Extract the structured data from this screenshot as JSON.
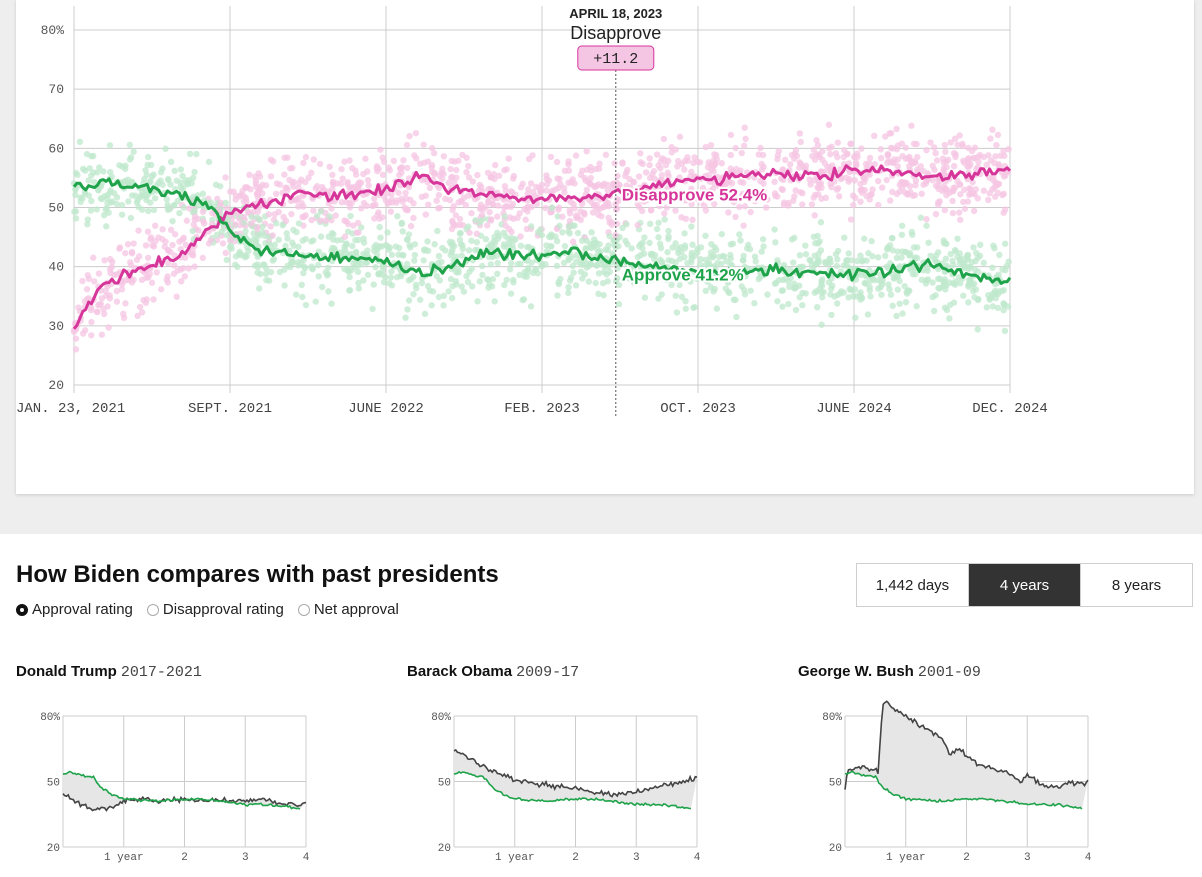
{
  "colors": {
    "approve": "#1ea34a",
    "disapprove": "#d6359a",
    "approve_band": "#bfe8cc",
    "disapprove_band": "#f5c6e3",
    "other_president": "#444444"
  },
  "chart_data": [
    {
      "type": "line",
      "x_ticks": [
        "JAN. 23, 2021",
        "SEPT. 2021",
        "JUNE 2022",
        "FEB. 2023",
        "OCT. 2023",
        "JUNE 2024",
        "DEC. 2024"
      ],
      "xlim": [
        "2021-01-23",
        "2024-12-01"
      ],
      "y_ticks": [
        "80%",
        "70",
        "60",
        "50",
        "40",
        "30",
        "20"
      ],
      "ylim": [
        20,
        80
      ],
      "grid": true,
      "series": [
        {
          "name": "Disapprove",
          "x": [
            "2021-01-23",
            "2021-03-01",
            "2021-05-01",
            "2021-07-01",
            "2021-08-15",
            "2021-09-15",
            "2021-11-01",
            "2022-01-01",
            "2022-03-01",
            "2022-05-01",
            "2022-07-01",
            "2022-08-15",
            "2022-10-01",
            "2022-12-01",
            "2023-02-01",
            "2023-04-18",
            "2023-06-01",
            "2023-08-01",
            "2023-10-01",
            "2023-12-01",
            "2024-02-01",
            "2024-04-01",
            "2024-06-01",
            "2024-08-01",
            "2024-10-01",
            "2024-12-01"
          ],
          "y": [
            29.5,
            36.5,
            39.5,
            42,
            46,
            49.5,
            50.5,
            52.5,
            52,
            53,
            55.5,
            53,
            52,
            51.5,
            51.5,
            52.4,
            53.5,
            54.5,
            55,
            55.8,
            55.5,
            56,
            56.3,
            55,
            55.5,
            56.5
          ]
        },
        {
          "name": "Approve",
          "x": [
            "2021-01-23",
            "2021-03-01",
            "2021-05-01",
            "2021-07-01",
            "2021-08-15",
            "2021-09-15",
            "2021-11-01",
            "2022-01-01",
            "2022-03-01",
            "2022-05-01",
            "2022-07-01",
            "2022-08-15",
            "2022-10-01",
            "2022-12-01",
            "2023-02-01",
            "2023-04-18",
            "2023-06-01",
            "2023-08-01",
            "2023-10-01",
            "2023-12-01",
            "2024-02-01",
            "2024-04-01",
            "2024-06-01",
            "2024-08-01",
            "2024-10-01",
            "2024-12-01"
          ],
          "y": [
            53.5,
            54.5,
            53.5,
            52.5,
            50,
            46,
            43,
            42,
            41.5,
            41,
            39,
            40,
            42.5,
            42,
            42.5,
            41.2,
            40.5,
            39.5,
            39,
            39.5,
            39,
            38.5,
            39,
            40.5,
            38.5,
            37.5
          ]
        }
      ],
      "labels": {
        "disapprove": "Disapprove 52.4%",
        "approve": "Approve 41.2%"
      },
      "tooltip": {
        "date": "APRIL 18, 2023",
        "series": "Disapprove",
        "margin": "+11.2"
      }
    },
    {
      "type": "line",
      "title": "Donald Trump",
      "subtitle": "2017-2021",
      "x_ticks": [
        "1 year",
        "2",
        "3",
        "4"
      ],
      "y_ticks": [
        "80%",
        "50",
        "20"
      ],
      "xlim": [
        0,
        4
      ],
      "ylim": [
        20,
        80
      ],
      "series": [
        {
          "name": "Approve (Trump)",
          "x": [
            0,
            0.1,
            0.3,
            0.5,
            0.8,
            1,
            1.3,
            1.6,
            2,
            2.3,
            2.6,
            3,
            3.3,
            3.6,
            4
          ],
          "y": [
            44,
            42,
            39,
            37,
            38,
            41,
            42,
            41,
            42,
            41,
            42,
            41,
            42,
            40,
            39
          ]
        },
        {
          "name": "Approve (Biden)",
          "x": [
            0,
            0.1,
            0.3,
            0.5,
            0.6,
            0.8,
            1,
            1.3,
            1.6,
            2,
            2.3,
            2.6,
            3,
            3.3,
            3.6,
            3.9
          ],
          "y": [
            53.5,
            54.5,
            53,
            52,
            48,
            44,
            42,
            41.5,
            41,
            42,
            42,
            41,
            39.5,
            39.5,
            39,
            37.5
          ]
        }
      ]
    },
    {
      "type": "line",
      "title": "Barack Obama",
      "subtitle": "2009-17",
      "x_ticks": [
        "1 year",
        "2",
        "3",
        "4"
      ],
      "y_ticks": [
        "80%",
        "50",
        "20"
      ],
      "xlim": [
        0,
        4
      ],
      "ylim": [
        20,
        80
      ],
      "series": [
        {
          "name": "Approve (Obama)",
          "x": [
            0,
            0.1,
            0.3,
            0.6,
            1,
            1.3,
            1.6,
            2,
            2.3,
            2.6,
            3,
            3.3,
            3.6,
            3.9,
            4
          ],
          "y": [
            64,
            63,
            60,
            55,
            51,
            49,
            48,
            47,
            45,
            44,
            45,
            47,
            49,
            51,
            52
          ]
        },
        {
          "name": "Approve (Biden)",
          "x": [
            0,
            0.1,
            0.3,
            0.5,
            0.6,
            0.8,
            1,
            1.3,
            1.6,
            2,
            2.3,
            2.6,
            3,
            3.3,
            3.6,
            3.9
          ],
          "y": [
            53.5,
            54.5,
            53,
            52,
            48,
            44,
            42,
            41.5,
            41,
            42,
            42,
            41,
            39.5,
            39.5,
            39,
            37.5
          ]
        }
      ]
    },
    {
      "type": "line",
      "title": "George W. Bush",
      "subtitle": "2001-09",
      "x_ticks": [
        "1 year",
        "2",
        "3",
        "4"
      ],
      "y_ticks": [
        "80%",
        "50",
        "20"
      ],
      "xlim": [
        0,
        4
      ],
      "ylim": [
        20,
        80
      ],
      "series": [
        {
          "name": "Approve (Bush)",
          "x": [
            0,
            0.05,
            0.3,
            0.55,
            0.62,
            0.68,
            1,
            1.3,
            1.6,
            1.75,
            1.85,
            2.1,
            2.3,
            2.6,
            2.9,
            3,
            3.2,
            3.5,
            3.7,
            3.9,
            4
          ],
          "y": [
            47,
            55,
            56,
            55,
            85,
            86,
            80,
            75,
            70,
            62,
            66,
            59,
            57,
            55,
            50,
            53,
            49,
            47,
            50,
            49,
            50
          ]
        },
        {
          "name": "Approve (Biden)",
          "x": [
            0,
            0.1,
            0.3,
            0.5,
            0.6,
            0.8,
            1,
            1.3,
            1.6,
            2,
            2.3,
            2.6,
            3,
            3.3,
            3.6,
            3.9
          ],
          "y": [
            53.5,
            54.5,
            53,
            52,
            48,
            44,
            42,
            41.5,
            41,
            42,
            42,
            41,
            39.5,
            39.5,
            39,
            37.5
          ]
        }
      ]
    }
  ],
  "comparison": {
    "title": "How Biden compares with past presidents",
    "radio_options": [
      {
        "label": "Approval rating",
        "selected": true
      },
      {
        "label": "Disapproval rating",
        "selected": false
      },
      {
        "label": "Net approval",
        "selected": false
      }
    ],
    "range_buttons": [
      {
        "label": "1,442 days",
        "active": false
      },
      {
        "label": "4 years",
        "active": true
      },
      {
        "label": "8 years",
        "active": false
      }
    ],
    "presidents": [
      {
        "name": "Donald Trump",
        "years": "2017-2021"
      },
      {
        "name": "Barack Obama",
        "years": "2009-17"
      },
      {
        "name": "George W. Bush",
        "years": "2001-09"
      }
    ]
  }
}
